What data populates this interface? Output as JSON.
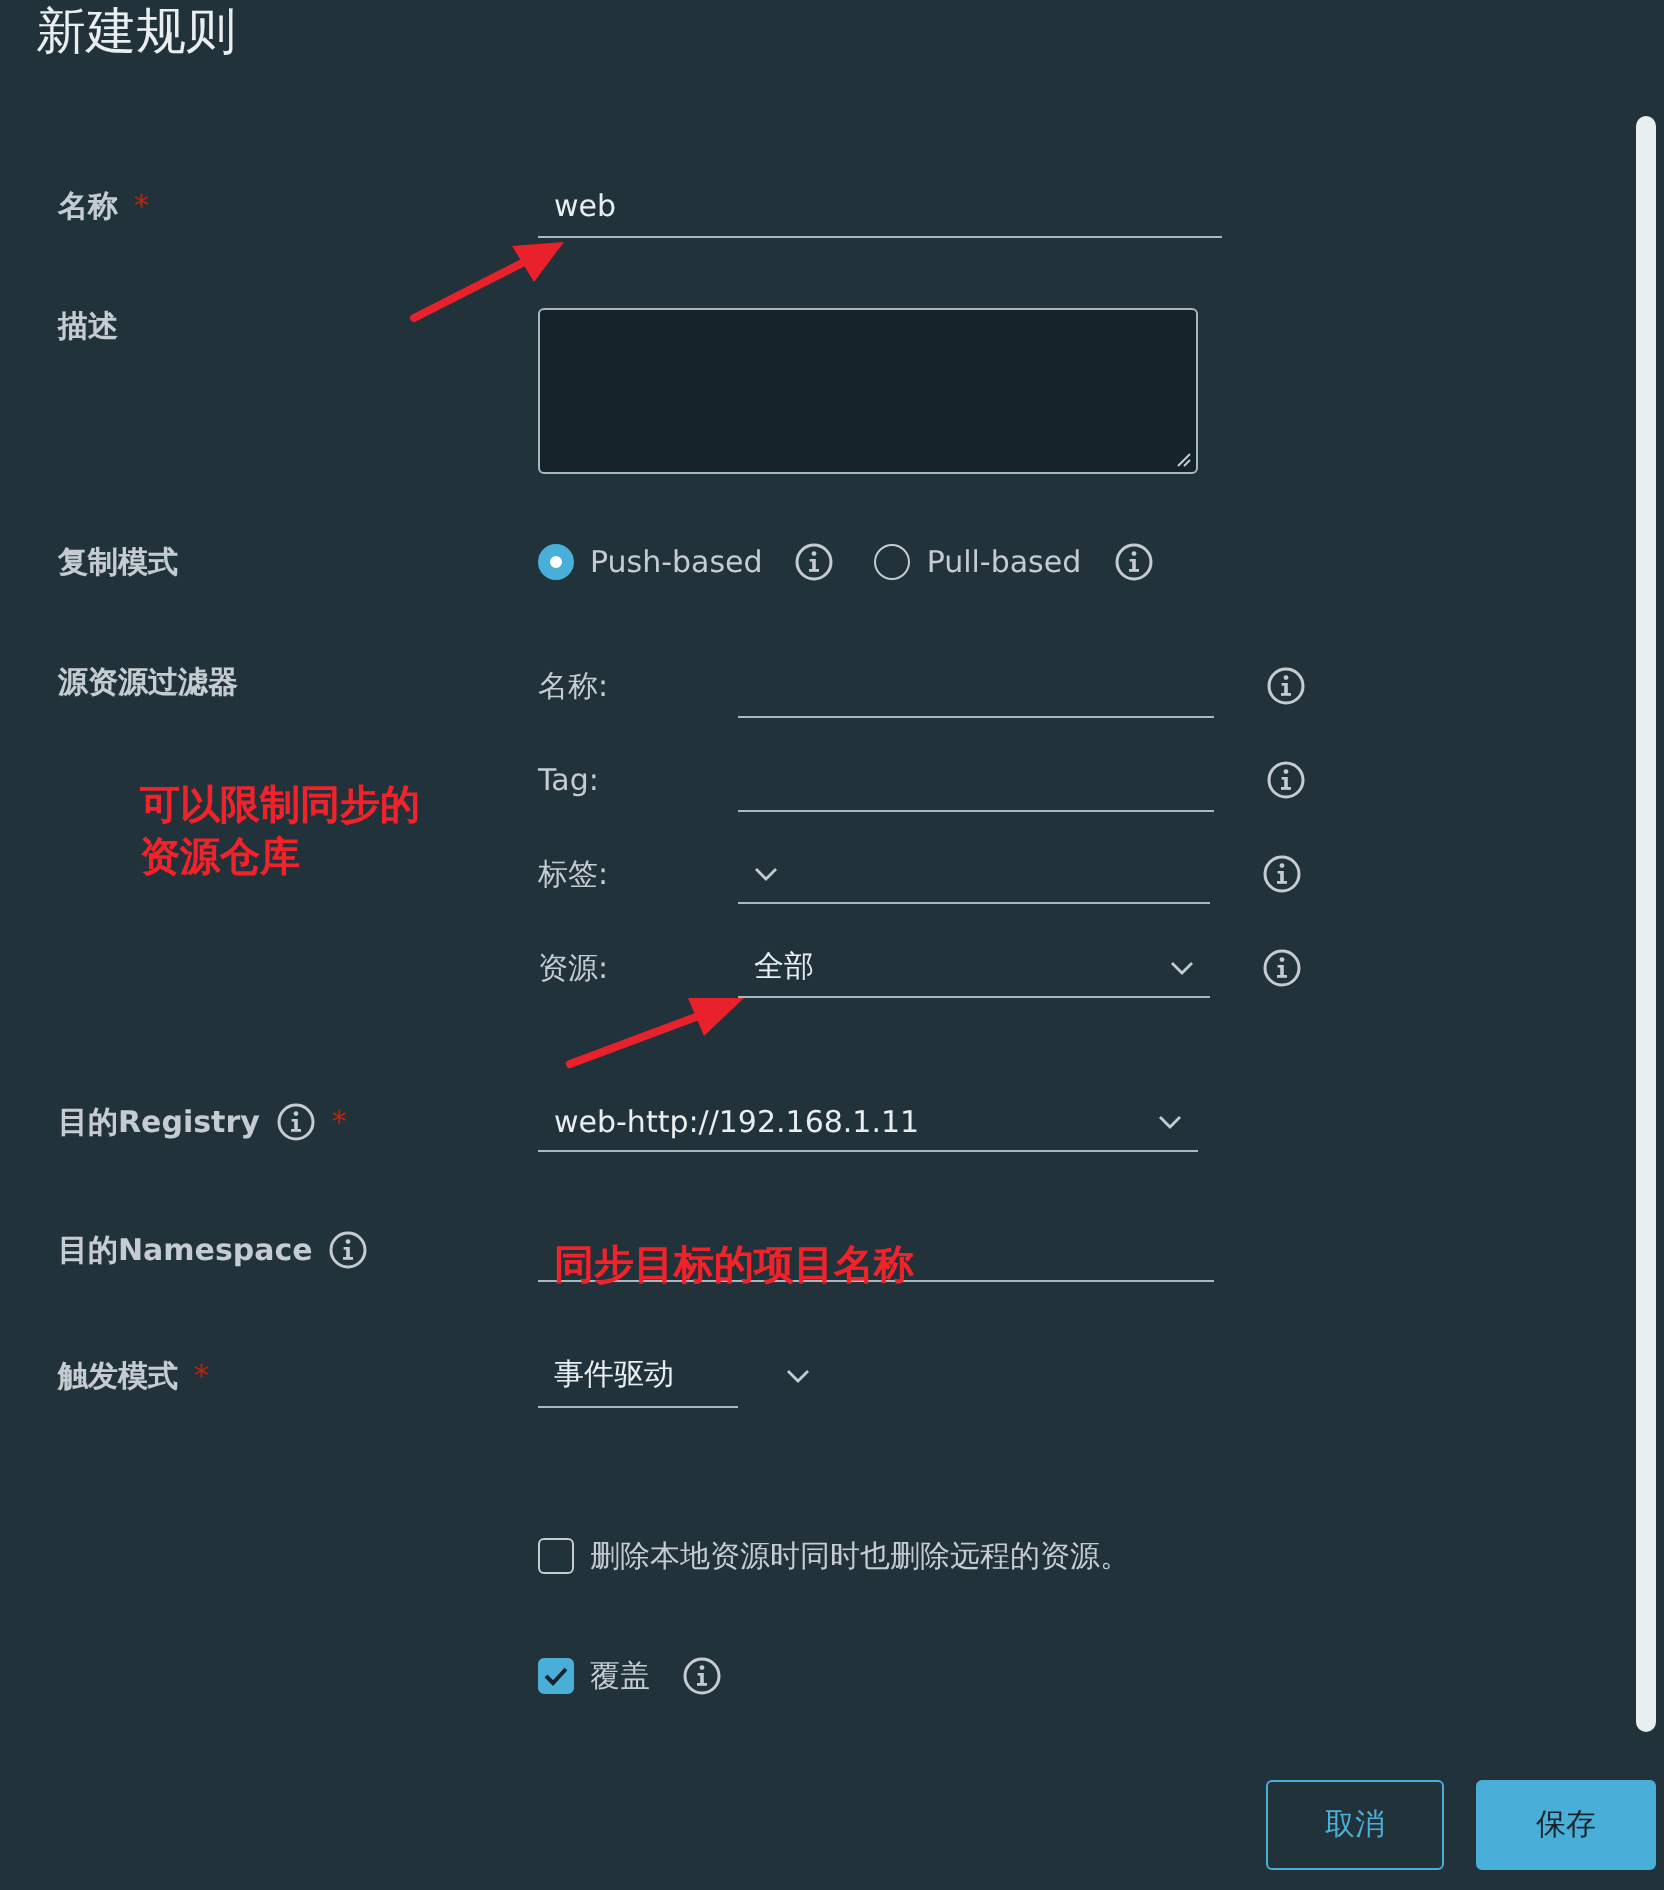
{
  "title": "新建规则",
  "form": {
    "name": {
      "label": "名称",
      "required_mark": "*",
      "value": "web"
    },
    "description": {
      "label": "描述"
    },
    "replication_mode": {
      "label": "复制模式",
      "options": [
        {
          "label": "Push-based",
          "selected": true,
          "info": true
        },
        {
          "label": "Pull-based",
          "selected": false,
          "info": true
        }
      ]
    },
    "source_filter": {
      "label": "源资源过滤器",
      "filters": [
        {
          "label": "名称:",
          "kind": "text",
          "info": true
        },
        {
          "label": "Tag:",
          "kind": "text",
          "info": true
        },
        {
          "label": "标签:",
          "kind": "select",
          "info": true
        },
        {
          "label": "资源:",
          "kind": "select",
          "value": "全部",
          "info": true
        }
      ]
    },
    "destination_registry": {
      "label": "目的Registry",
      "info": true,
      "required_mark": "*",
      "value": "web-http://192.168.1.11"
    },
    "destination_namespace": {
      "label": "目的Namespace",
      "info": true
    },
    "trigger_mode": {
      "label": "触发模式",
      "required_mark": "*",
      "value": "事件驱动"
    },
    "options": [
      {
        "label": "删除本地资源时同时也删除远程的资源。",
        "checked": false,
        "info": false
      },
      {
        "label": "覆盖",
        "checked": true,
        "info": true
      }
    ]
  },
  "buttons": [
    {
      "label": "取消",
      "kind": "secondary"
    },
    {
      "label": "保存",
      "kind": "primary"
    }
  ],
  "annotations": [
    {
      "lines": [
        "可以限制同步的",
        "资源仓库"
      ],
      "kind": "filter-note"
    },
    {
      "lines": [
        "同步目标的项目名称"
      ],
      "kind": "namespace-note"
    }
  ]
}
